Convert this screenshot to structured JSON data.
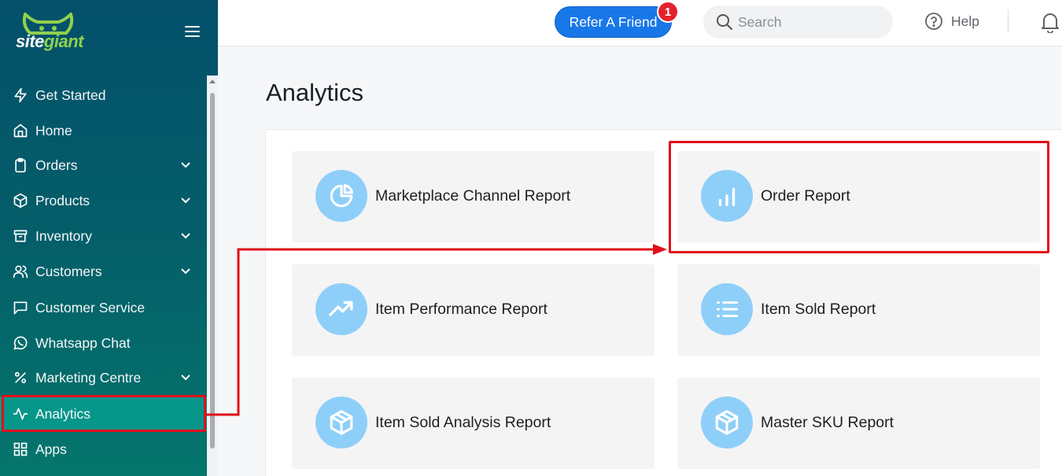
{
  "brand": {
    "name_part1": "site",
    "name_part2": "giant",
    "accent_color": "#8fd14f"
  },
  "sidebar": {
    "items": [
      {
        "label": "Get Started",
        "icon": "lightning-icon",
        "has_chevron": false
      },
      {
        "label": "Home",
        "icon": "home-icon",
        "has_chevron": false
      },
      {
        "label": "Orders",
        "icon": "clipboard-icon",
        "has_chevron": true
      },
      {
        "label": "Products",
        "icon": "box-icon",
        "has_chevron": true
      },
      {
        "label": "Inventory",
        "icon": "archive-icon",
        "has_chevron": true
      },
      {
        "label": "Customers",
        "icon": "users-icon",
        "has_chevron": true
      },
      {
        "label": "Customer Service",
        "icon": "message-icon",
        "has_chevron": false
      },
      {
        "label": "Whatsapp Chat",
        "icon": "whatsapp-icon",
        "has_chevron": false
      },
      {
        "label": "Marketing Centre",
        "icon": "percent-icon",
        "has_chevron": true
      },
      {
        "label": "Analytics",
        "icon": "activity-icon",
        "has_chevron": false,
        "active": true
      },
      {
        "label": "Apps",
        "icon": "grid-icon",
        "has_chevron": false
      }
    ]
  },
  "topbar": {
    "refer_label": "Refer A Friend",
    "refer_badge": "1",
    "search_placeholder": "Search",
    "help_label": "Help"
  },
  "main": {
    "title": "Analytics",
    "cards": [
      {
        "title": "Marketplace Channel Report",
        "icon": "pie-chart-icon"
      },
      {
        "title": "Order Report",
        "icon": "bar-chart-icon"
      },
      {
        "title": "Item Performance Report",
        "icon": "trending-up-icon"
      },
      {
        "title": "Item Sold Report",
        "icon": "list-icon"
      },
      {
        "title": "Item Sold Analysis Report",
        "icon": "package-icon"
      },
      {
        "title": "Master SKU Report",
        "icon": "package-icon"
      }
    ]
  },
  "colors": {
    "sidebar_active": "#07968a",
    "refer_button": "#1877e8",
    "icon_circle": "#8ecff9",
    "annotation": "#e0101a"
  }
}
